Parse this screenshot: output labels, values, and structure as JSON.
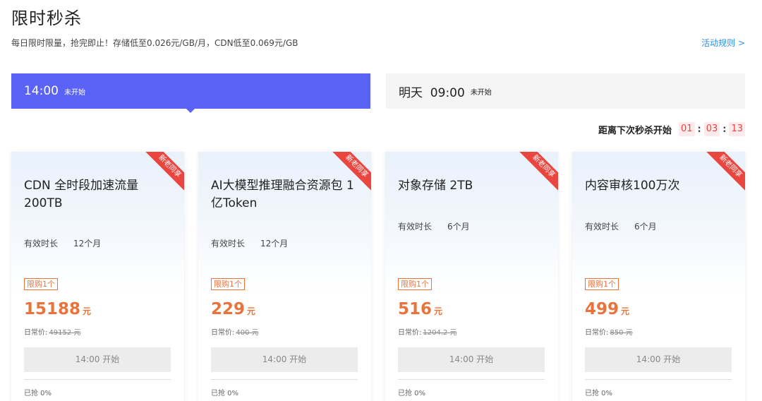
{
  "page": {
    "title": "限时秒杀",
    "subtitle": "每日限时限量，抢完即止！存储低至0.026元/GB/月，CDN低至0.069元/GB",
    "rules_link": "活动规则 >"
  },
  "sessions": [
    {
      "time": "14:00",
      "status": "未开始",
      "active": true
    },
    {
      "time": "明天  09:00",
      "status": "未开始",
      "active": false
    }
  ],
  "countdown": {
    "label": "距离下次秒杀开始",
    "hours": "01",
    "minutes": "03",
    "seconds": "13",
    "separator": ":"
  },
  "cards": [
    {
      "ribbon": "新老同享",
      "name": "CDN 全时段加速流量 200TB",
      "duration_label": "有效时长",
      "duration_value": "12个月",
      "limit": "限购1个",
      "price": "15188",
      "price_unit": "元",
      "orig_label": "日常价:",
      "orig_price": "49152 元",
      "button": "14:00 开始",
      "sold": "已抢 0%"
    },
    {
      "ribbon": "新老同享",
      "name": "AI大模型推理融合资源包 1亿Token",
      "duration_label": "有效时长",
      "duration_value": "12个月",
      "limit": "限购1个",
      "price": "229",
      "price_unit": "元",
      "orig_label": "日常价:",
      "orig_price": "400 元",
      "button": "14:00 开始",
      "sold": "已抢 0%"
    },
    {
      "ribbon": "新老同享",
      "name": "对象存储 2TB",
      "duration_label": "有效时长",
      "duration_value": "6个月",
      "limit": "限购1个",
      "price": "516",
      "price_unit": "元",
      "orig_label": "日常价:",
      "orig_price": "1204.2 元",
      "button": "14:00 开始",
      "sold": "已抢 0%"
    },
    {
      "ribbon": "新老同享",
      "name": "内容审核100万次",
      "duration_label": "有效时长",
      "duration_value": "6个月",
      "limit": "限购1个",
      "price": "499",
      "price_unit": "元",
      "orig_label": "日常价:",
      "orig_price": "850 元",
      "button": "14:00 开始",
      "sold": "已抢 0%"
    }
  ]
}
